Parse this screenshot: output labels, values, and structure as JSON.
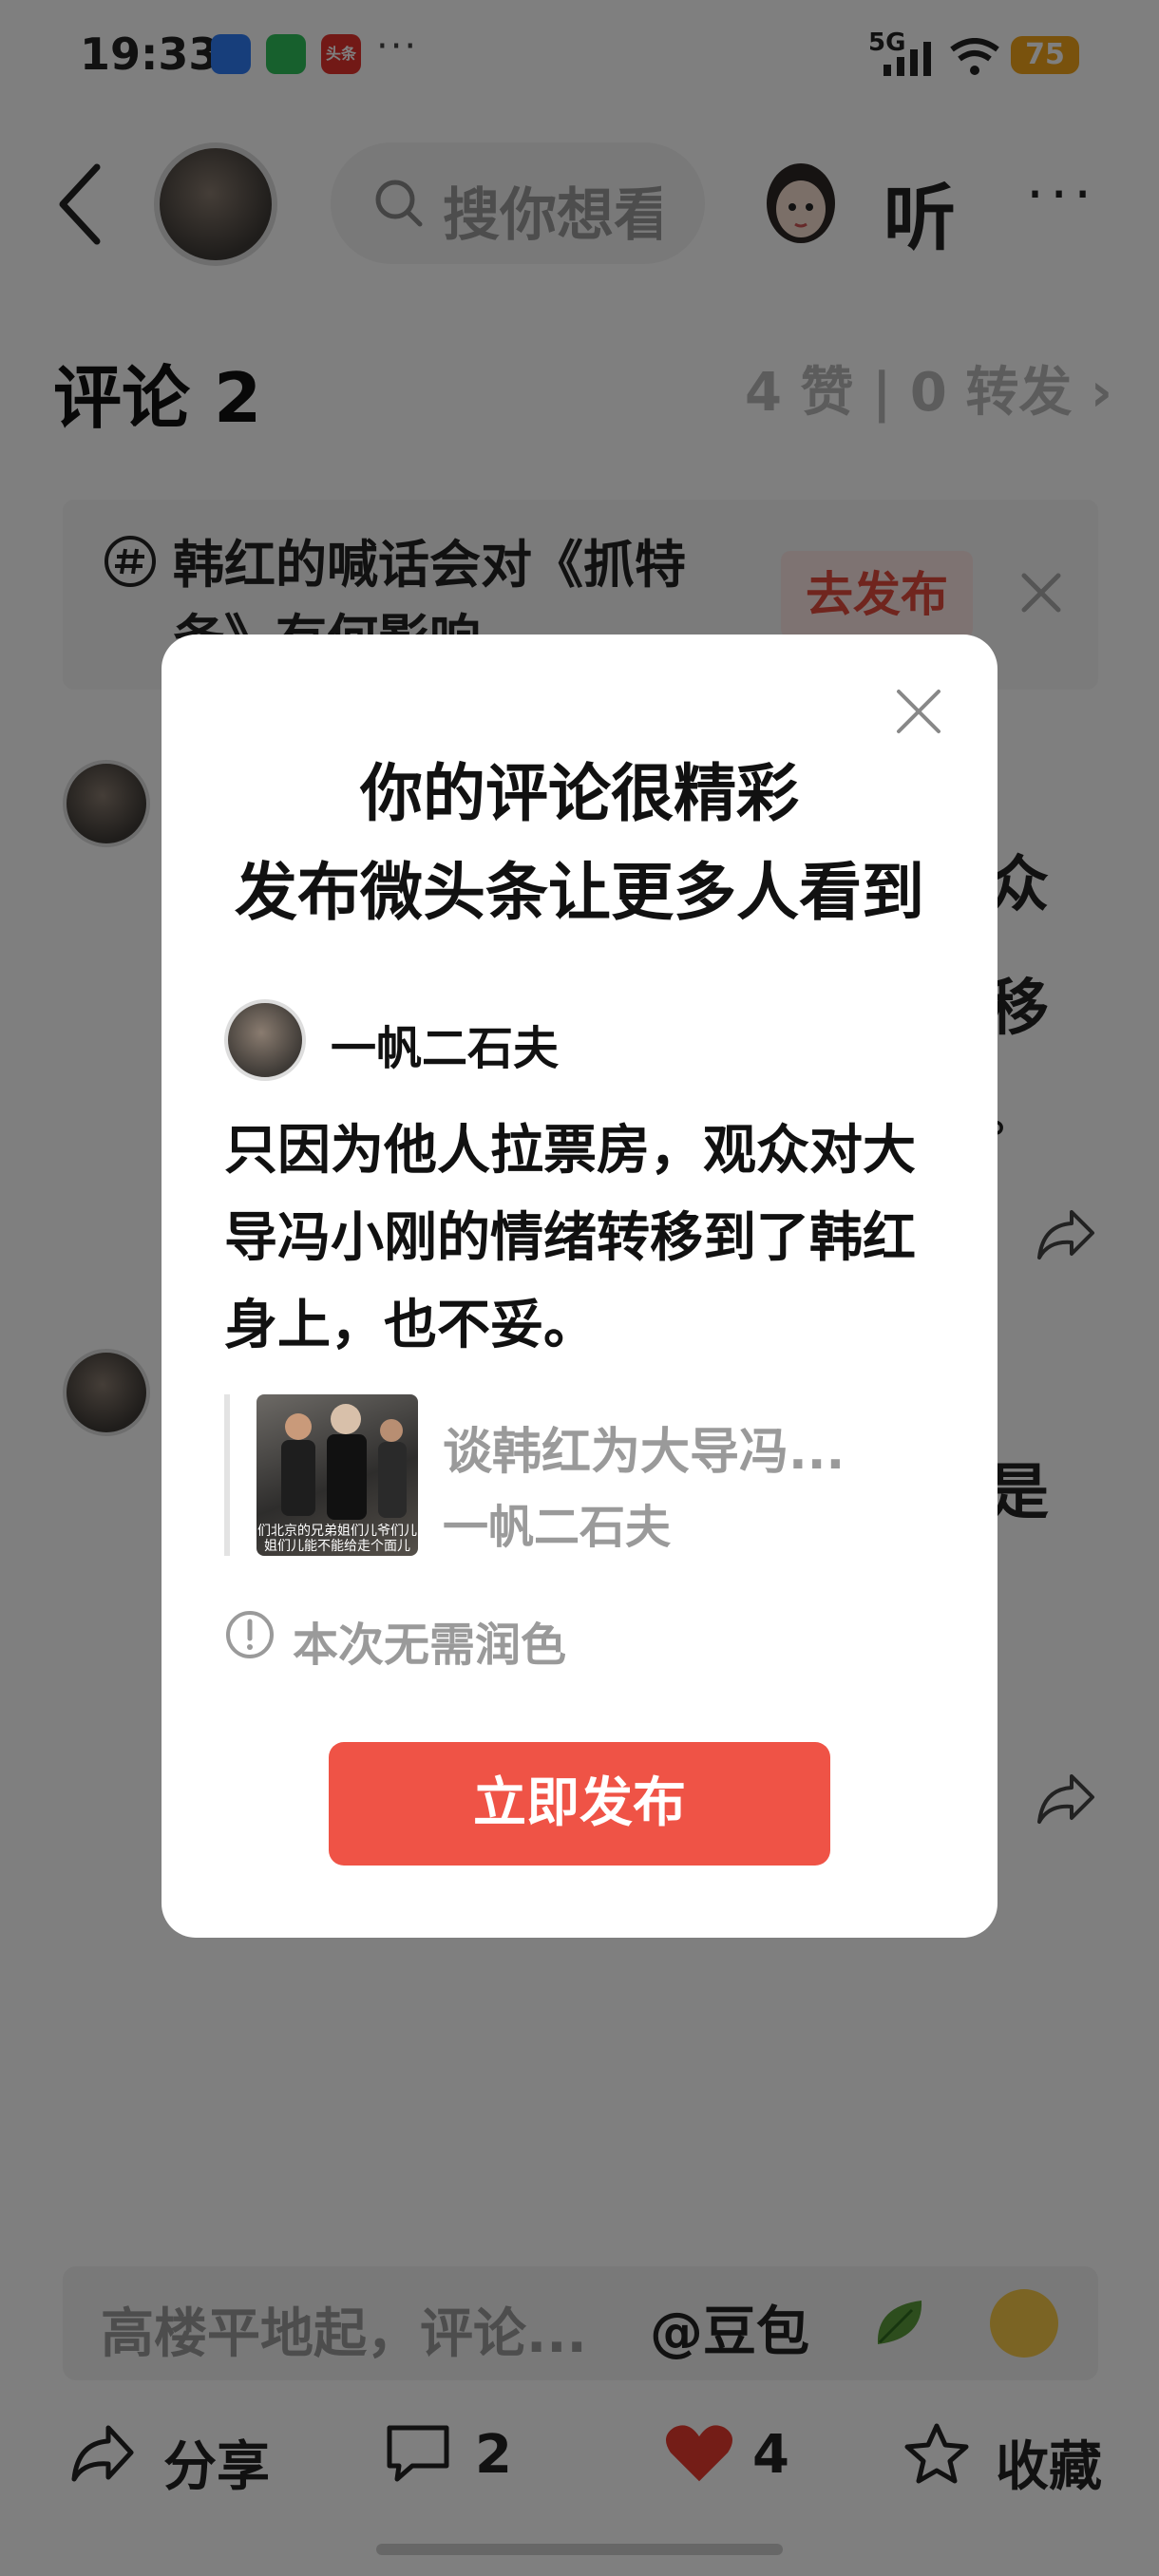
{
  "status_bar": {
    "time": "19:33",
    "more_indicator": "···",
    "network": "5G",
    "battery": "75",
    "app_icons": [
      "browser-icon",
      "wechat-icon",
      "toutiao-icon"
    ],
    "toutiao_label": "头条"
  },
  "header": {
    "search_placeholder": "搜你想看",
    "listen_label": "听",
    "more_label": "···"
  },
  "comments": {
    "title": "评论 2",
    "stats": "4 赞 | 0 转发 ›"
  },
  "topic": {
    "text": "韩红的喊话会对《抓特务》有何影响",
    "publish_button": "去发布"
  },
  "background_comments": {
    "fragments": [
      "众",
      "移",
      "。",
      "是"
    ]
  },
  "composer": {
    "placeholder": "高楼平地起，评论...",
    "mention": "@豆包"
  },
  "bottom_bar": {
    "share_label": "分享",
    "comment_count": "2",
    "like_count": "4",
    "favorite_label": "收藏",
    "like_color": "#e83a2e"
  },
  "dialog": {
    "title_line1": "你的评论很精彩",
    "title_line2": "发布微头条让更多人看到",
    "author": "一帆二石夫",
    "body": "只因为他人拉票房，观众对大导冯小刚的情绪转移到了韩红身上，也不妥。",
    "quote_title": "谈韩红为大导冯...",
    "quote_author": "一帆二石夫",
    "thumb_caption": "们北京的兄弟姐们儿爷们儿姐们儿能不能给走个面儿",
    "note": "本次无需润色",
    "publish_button": "立即发布",
    "accent_color": "#ef5346"
  }
}
